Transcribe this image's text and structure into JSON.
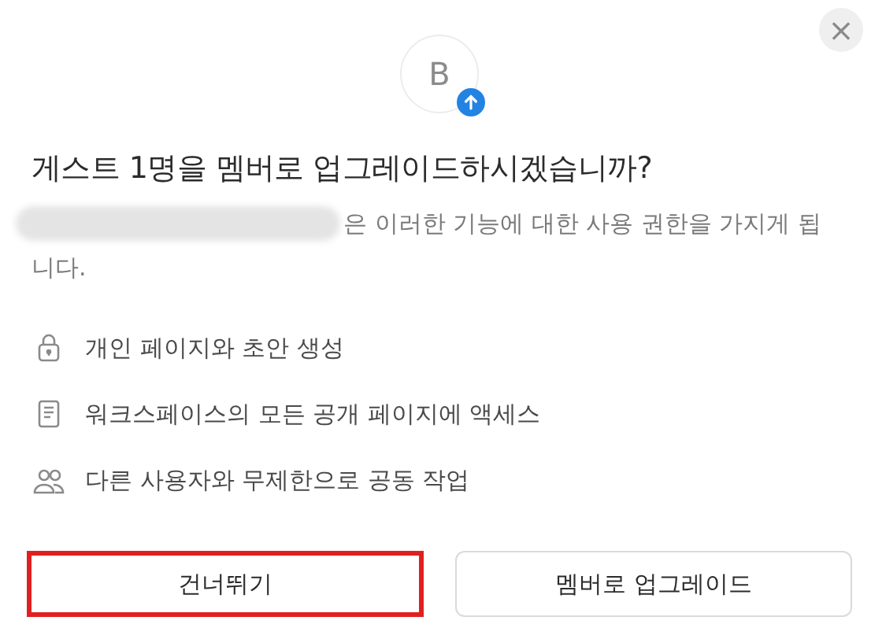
{
  "close_button": {
    "label": "×"
  },
  "avatar": {
    "initial": "B",
    "upgrade_badge": true
  },
  "title": "게스트 1명을 멤버로 업그레이드하시겠습니까?",
  "description": {
    "redacted": true,
    "lines": [
      "은 이러한 기능에 대한 사용 권한을 가지게 됩",
      "니다."
    ]
  },
  "features": [
    {
      "kind": "lock",
      "text": "개인 페이지와 초안 생성"
    },
    {
      "kind": "document",
      "text": "워크스페이스의 모든 공개 페이지에 액세스"
    },
    {
      "kind": "people",
      "text": "다른 사용자와 무제한으로 공동 작업"
    }
  ],
  "buttons": [
    {
      "label": "건너뛰기",
      "highlighted": true
    },
    {
      "label": "멤버로 업그레이드",
      "highlighted": false
    }
  ]
}
